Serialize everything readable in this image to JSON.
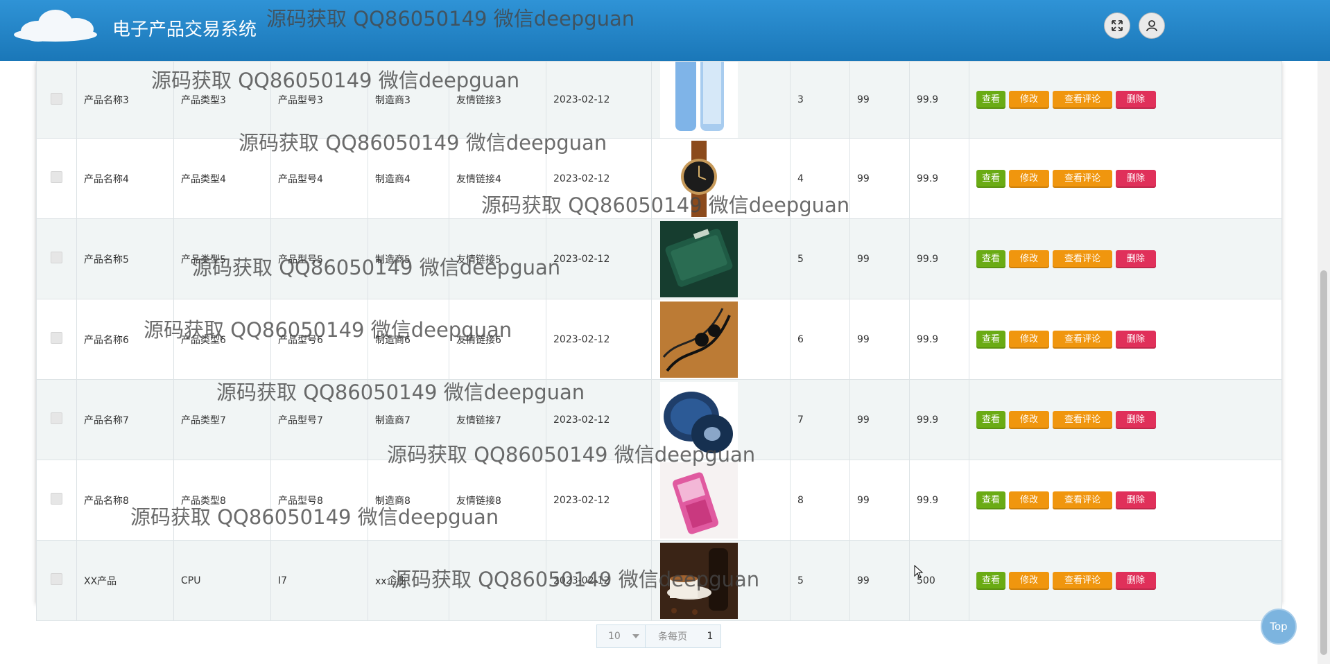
{
  "header": {
    "app_title": "电子产品交易系统",
    "fullscreen_icon": "fullscreen-icon",
    "user_icon": "user-icon"
  },
  "watermark_text": "源码获取 QQ86050149 微信deepguan",
  "products": [
    {
      "name": "产品名称3",
      "type": "产品类型3",
      "model": "产品型号3",
      "maker": "制造商3",
      "link": "友情链接3",
      "date": "2023-02-12",
      "image": "blue-smartphone",
      "stock": "3",
      "a": "99",
      "price": "99.9"
    },
    {
      "name": "产品名称4",
      "type": "产品类型4",
      "model": "产品型号4",
      "maker": "制造商4",
      "link": "友情链接4",
      "date": "2023-02-12",
      "image": "wrist-watch",
      "stock": "4",
      "a": "99",
      "price": "99.9"
    },
    {
      "name": "产品名称5",
      "type": "产品类型5",
      "model": "产品型号5",
      "maker": "制造商5",
      "link": "友情链接5",
      "date": "2023-02-12",
      "image": "green-power-bank",
      "stock": "5",
      "a": "99",
      "price": "99.9"
    },
    {
      "name": "产品名称6",
      "type": "产品类型6",
      "model": "产品型号6",
      "maker": "制造商6",
      "link": "友情链接6",
      "date": "2023-02-12",
      "image": "black-earphones",
      "stock": "6",
      "a": "99",
      "price": "99.9"
    },
    {
      "name": "产品名称7",
      "type": "产品类型7",
      "model": "产品型号7",
      "maker": "制造商7",
      "link": "友情链接7",
      "date": "2023-02-12",
      "image": "component-reels",
      "stock": "7",
      "a": "99",
      "price": "99.9"
    },
    {
      "name": "产品名称8",
      "type": "产品类型8",
      "model": "产品型号8",
      "maker": "制造商8",
      "link": "友情链接8",
      "date": "2023-02-12",
      "image": "pink-phone",
      "stock": "8",
      "a": "99",
      "price": "99.9"
    },
    {
      "name": "XX产品",
      "type": "CPU",
      "model": "I7",
      "maker": "xx企业",
      "link": "",
      "date": "2023-02-12",
      "image": "coffee-cup",
      "stock": "5",
      "a": "99",
      "price": "500"
    }
  ],
  "actions": {
    "view": "查看",
    "edit": "修改",
    "comments": "查看评论",
    "delete": "删除"
  },
  "pagination": {
    "page_size": "10",
    "per_page_label": "条每页",
    "page": "1"
  },
  "top_button": "Top",
  "colors": {
    "header": "#1f80c4",
    "view": "#6aab14",
    "edit": "#f0960e",
    "delete": "#e0305a"
  }
}
